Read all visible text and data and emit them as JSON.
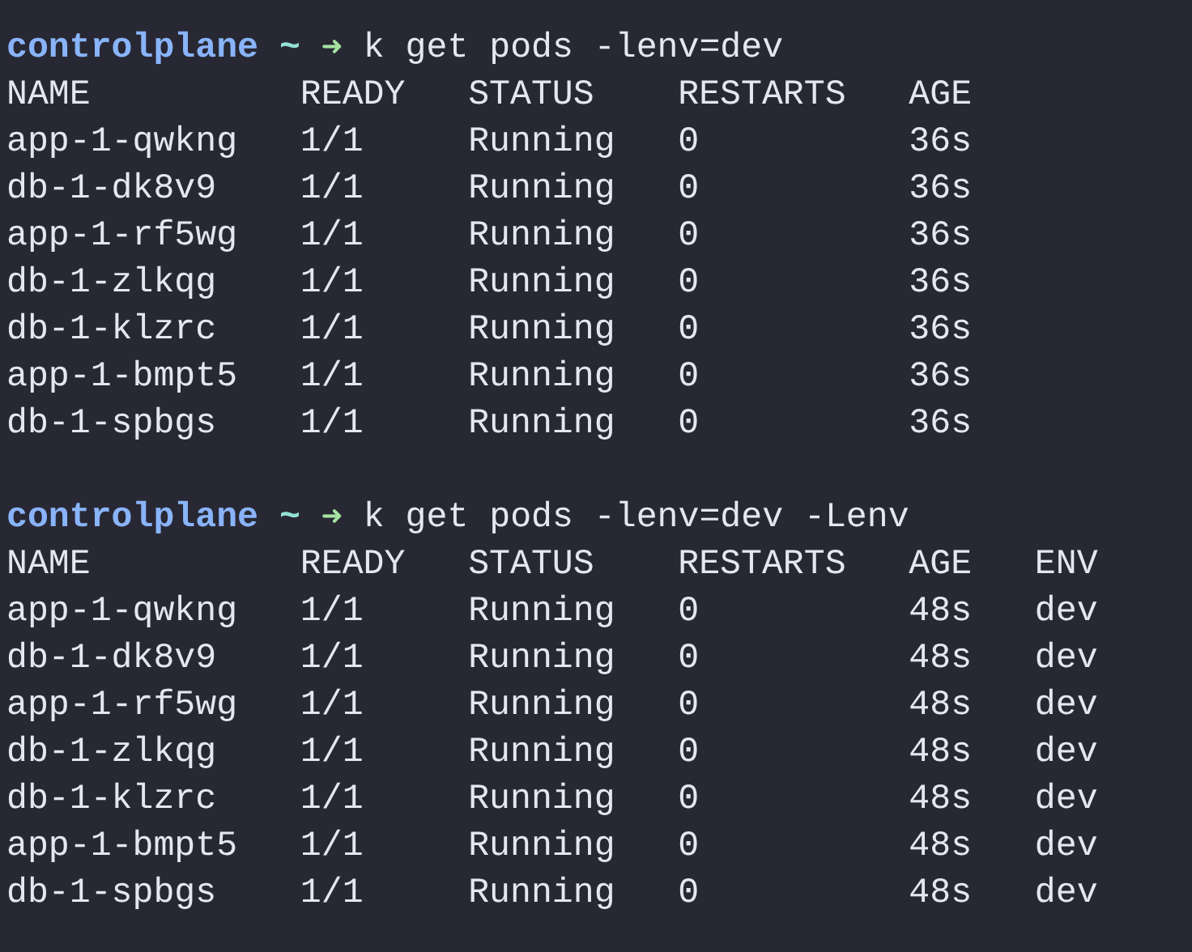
{
  "blocks": [
    {
      "prompt": {
        "host": "controlplane",
        "dir": "~",
        "arrow": "➜",
        "command": "k get pods -lenv=dev"
      },
      "columns": [
        "NAME",
        "READY",
        "STATUS",
        "RESTARTS",
        "AGE"
      ],
      "rows": [
        [
          "app-1-qwkng",
          "1/1",
          "Running",
          "0",
          "36s"
        ],
        [
          "db-1-dk8v9",
          "1/1",
          "Running",
          "0",
          "36s"
        ],
        [
          "app-1-rf5wg",
          "1/1",
          "Running",
          "0",
          "36s"
        ],
        [
          "db-1-zlkqg",
          "1/1",
          "Running",
          "0",
          "36s"
        ],
        [
          "db-1-klzrc",
          "1/1",
          "Running",
          "0",
          "36s"
        ],
        [
          "app-1-bmpt5",
          "1/1",
          "Running",
          "0",
          "36s"
        ],
        [
          "db-1-spbgs",
          "1/1",
          "Running",
          "0",
          "36s"
        ]
      ]
    },
    {
      "prompt": {
        "host": "controlplane",
        "dir": "~",
        "arrow": "➜",
        "command": "k get pods -lenv=dev -Lenv"
      },
      "columns": [
        "NAME",
        "READY",
        "STATUS",
        "RESTARTS",
        "AGE",
        "ENV"
      ],
      "rows": [
        [
          "app-1-qwkng",
          "1/1",
          "Running",
          "0",
          "48s",
          "dev"
        ],
        [
          "db-1-dk8v9",
          "1/1",
          "Running",
          "0",
          "48s",
          "dev"
        ],
        [
          "app-1-rf5wg",
          "1/1",
          "Running",
          "0",
          "48s",
          "dev"
        ],
        [
          "db-1-zlkqg",
          "1/1",
          "Running",
          "0",
          "48s",
          "dev"
        ],
        [
          "db-1-klzrc",
          "1/1",
          "Running",
          "0",
          "48s",
          "dev"
        ],
        [
          "app-1-bmpt5",
          "1/1",
          "Running",
          "0",
          "48s",
          "dev"
        ],
        [
          "db-1-spbgs",
          "1/1",
          "Running",
          "0",
          "48s",
          "dev"
        ]
      ]
    }
  ]
}
